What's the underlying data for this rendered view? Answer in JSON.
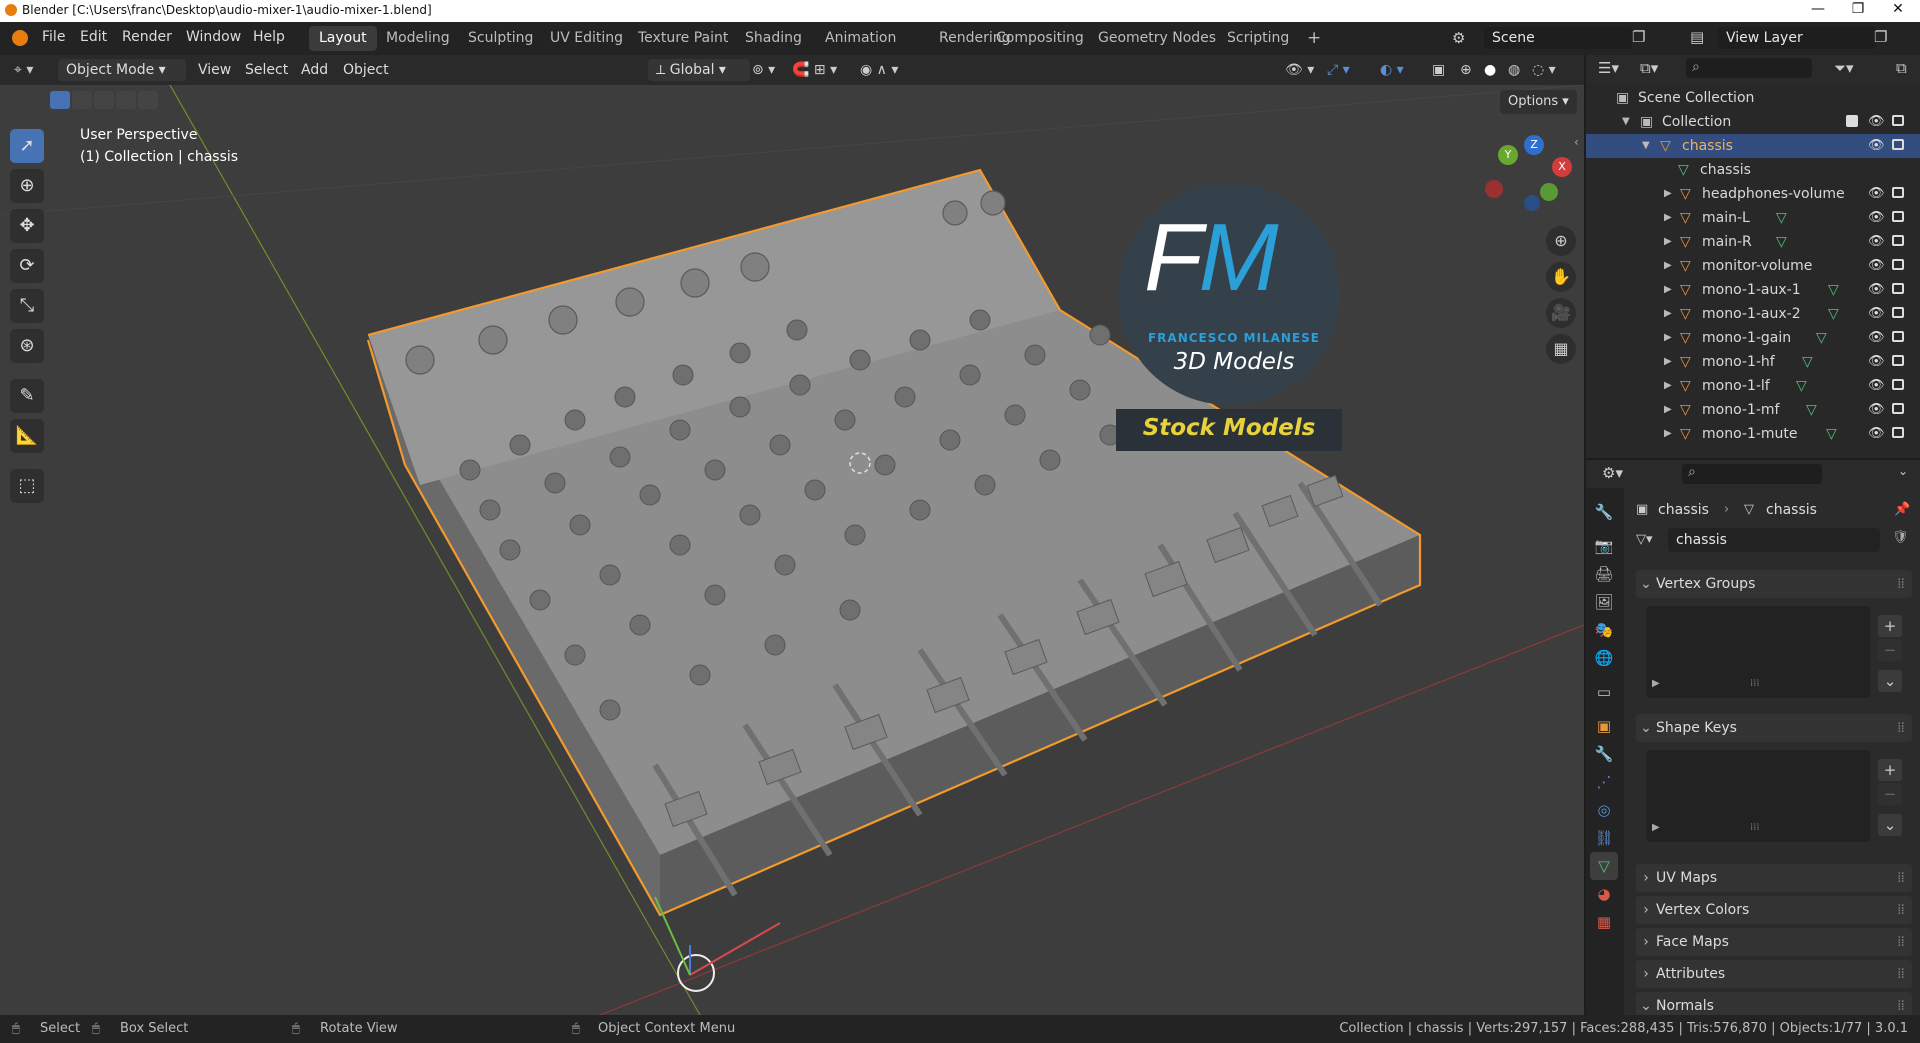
{
  "title_bar": {
    "title": "Blender [C:\\Users\\franc\\Desktop\\audio-mixer-1\\audio-mixer-1.blend]",
    "min": "—",
    "max": "❐",
    "close": "✕"
  },
  "menu": [
    "File",
    "Edit",
    "Render",
    "Window",
    "Help"
  ],
  "workspaces": [
    "Layout",
    "Modeling",
    "Sculpting",
    "UV Editing",
    "Texture Paint",
    "Shading",
    "Animation",
    "Rendering",
    "Compositing",
    "Geometry Nodes",
    "Scripting"
  ],
  "active_workspace": "Layout",
  "add_workspace": "+",
  "scene": {
    "label": "Scene",
    "view_layer": "View Layer"
  },
  "viewport_header": {
    "mode": "Object Mode",
    "menus": [
      "View",
      "Select",
      "Add",
      "Object"
    ],
    "orientation": "Global",
    "options": "Options"
  },
  "viewport_overlay": {
    "perspective": "User Perspective",
    "collection": "(1) Collection | chassis"
  },
  "gizmo": {
    "x": "X",
    "y": "Y",
    "z": "Z"
  },
  "watermark": {
    "logo": "FM",
    "name": "FRANCESCO MILANESE",
    "line": "3D Models",
    "banner": "Stock Models"
  },
  "tools": [
    "select-box",
    "cursor",
    "move",
    "rotate",
    "scale",
    "transform",
    "annotate",
    "measure",
    "add-cube"
  ],
  "outliner": {
    "scene_collection": "Scene Collection",
    "collection": "Collection",
    "items": [
      {
        "name": "chassis",
        "selected": true,
        "expanded": true
      },
      {
        "name": "chassis",
        "child": true
      },
      {
        "name": "headphones-volume"
      },
      {
        "name": "main-L"
      },
      {
        "name": "main-R"
      },
      {
        "name": "monitor-volume"
      },
      {
        "name": "mono-1-aux-1"
      },
      {
        "name": "mono-1-aux-2"
      },
      {
        "name": "mono-1-gain"
      },
      {
        "name": "mono-1-hf"
      },
      {
        "name": "mono-1-lf"
      },
      {
        "name": "mono-1-mf"
      },
      {
        "name": "mono-1-mute"
      }
    ]
  },
  "properties": {
    "breadcrumb_obj": "chassis",
    "breadcrumb_mesh": "chassis",
    "mesh_name": "chassis",
    "panels": [
      {
        "label": "Vertex Groups",
        "open": true
      },
      {
        "label": "Shape Keys",
        "open": true
      },
      {
        "label": "UV Maps",
        "open": false
      },
      {
        "label": "Vertex Colors",
        "open": false
      },
      {
        "label": "Face Maps",
        "open": false
      },
      {
        "label": "Attributes",
        "open": false
      },
      {
        "label": "Normals",
        "open": true
      }
    ]
  },
  "status_bar": {
    "select": "Select",
    "box_select": "Box Select",
    "rotate_view": "Rotate View",
    "context_menu": "Object Context Menu",
    "stats": "Collection | chassis | Verts:297,157 | Faces:288,435 | Tris:576,870 | Objects:1/77 | 3.0.1"
  },
  "colors": {
    "accent": "#4772b3",
    "selection_outline": "#f29a2e",
    "mesh_icon": "#52c27e",
    "object_icon": "#e39a3b",
    "watermark_blue": "#2a9fd8",
    "banner_text": "#e8d23a"
  }
}
